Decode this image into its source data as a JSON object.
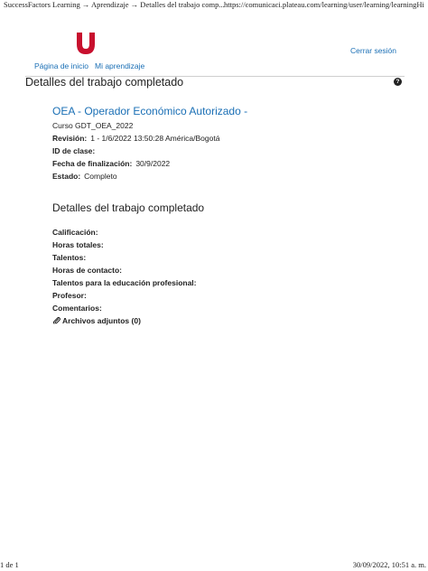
{
  "print_header": {
    "left": "SuccessFactors Learning → Aprendizaje → Detalles del trabajo comp...",
    "right": "https://comunicaci.plateau.com/learning/user/learning/learningHistor..."
  },
  "brand": {
    "logo_icon": "u-logo-icon",
    "color": "#c8102e"
  },
  "nav": {
    "home": "Página de inicio",
    "my_learning": "Mi aprendizaje",
    "sign_out": "Cerrar sesión"
  },
  "page_title": "Detalles del trabajo completado",
  "help_icon": {
    "icon": "question-circle-icon",
    "glyph": "?"
  },
  "course": {
    "title": "OEA - Operador Económico Autorizado -",
    "code": "Curso GDT_OEA_2022",
    "revision_label": "Revisión:",
    "revision_value": "1 - 1/6/2022 13:50:28 América/Bogotá",
    "class_id_label": "ID de clase:",
    "class_id_value": "",
    "completion_date_label": "Fecha de finalización:",
    "completion_date_value": "30/9/2022",
    "status_label": "Estado:",
    "status_value": "Completo"
  },
  "details": {
    "title": "Detalles del trabajo completado",
    "grade_label": "Calificación:",
    "total_hours_label": "Horas totales:",
    "talents_label": "Talentos:",
    "contact_hours_label": "Horas de contacto:",
    "pro_ed_talents_label": "Talentos para la educación profesional:",
    "instructor_label": "Profesor:",
    "comments_label": "Comentarios:",
    "attachments_label": "Archivos adjuntos (0)",
    "attachments_icon": "paperclip-icon"
  },
  "print_footer": {
    "left": "1 de 1",
    "right": "30/09/2022, 10:51 a. m."
  }
}
